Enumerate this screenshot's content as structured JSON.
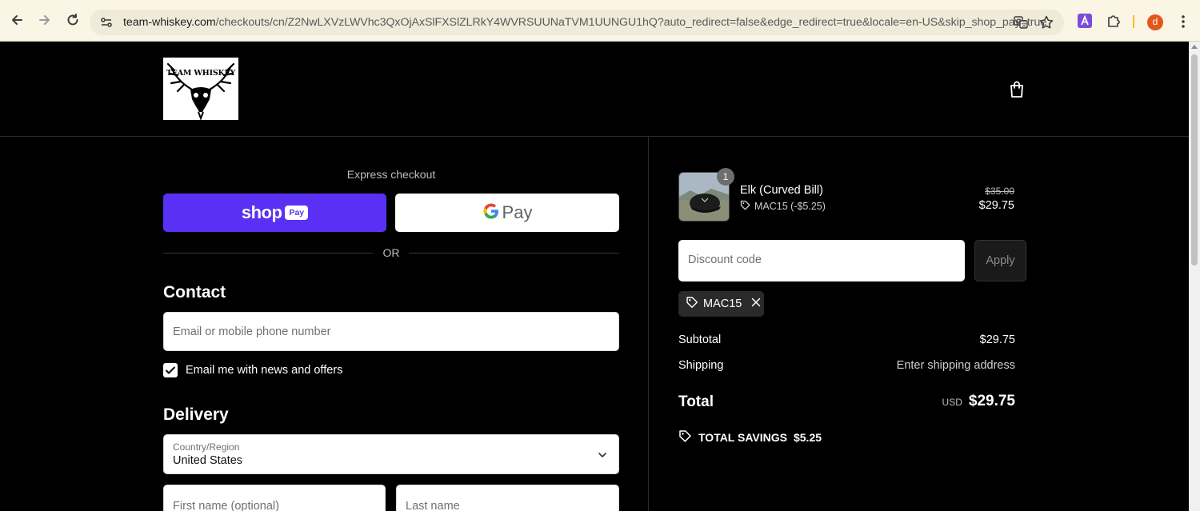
{
  "browser": {
    "url_host": "team-whiskey.com",
    "url_rest": "/checkouts/cn/Z2NwLXVzLWVhc3QxOjAxSlFXSlZLRkY4WVRSUUNaTVM1UUNGU1hQ?auto_redirect=false&edge_redirect=true&locale=en-US&skip_shop_pay=true",
    "profile_initial": "d",
    "icons": [
      "back-icon",
      "forward-icon",
      "reload-icon",
      "site-settings-icon",
      "translate-icon",
      "star-icon",
      "extension-a-icon",
      "extensions-puzzle-icon",
      "menu-kebab-icon"
    ]
  },
  "header": {
    "logo_text": "TEAM WHISKEY"
  },
  "express": {
    "label": "Express checkout",
    "shop_pay_word": "shop",
    "shop_pay_box": "Pay",
    "google_pay_word": "Pay",
    "or_text": "OR"
  },
  "contact": {
    "heading": "Contact",
    "email_placeholder": "Email or mobile phone number",
    "newsletter_label": "Email me with news and offers",
    "newsletter_checked": true
  },
  "delivery": {
    "heading": "Delivery",
    "country_label": "Country/Region",
    "country_value": "United States",
    "first_name_placeholder": "First name (optional)",
    "last_name_placeholder": "Last name"
  },
  "order": {
    "item": {
      "name": "Elk (Curved Bill)",
      "quantity": "1",
      "discount": "MAC15 (-$5.25)",
      "original_price": "$35.00",
      "price": "$29.75"
    },
    "discount_placeholder": "Discount code",
    "apply_label": "Apply",
    "applied_code": "MAC15",
    "subtotal_label": "Subtotal",
    "subtotal_value": "$29.75",
    "shipping_label": "Shipping",
    "shipping_value": "Enter shipping address",
    "total_label": "Total",
    "total_currency": "USD",
    "total_value": "$29.75",
    "savings_label": "TOTAL SAVINGS",
    "savings_value": "$5.25"
  },
  "colors": {
    "shop_pay": "#5a31f4",
    "page_bg": "#000000",
    "chrome_bg": "#fbf5e6"
  }
}
